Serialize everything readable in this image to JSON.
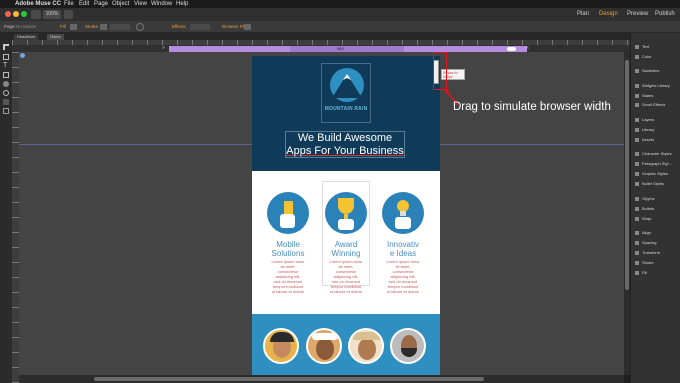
{
  "menubar": {
    "app_name": "Adobe Muse CC",
    "items": [
      "File",
      "Edit",
      "Page",
      "Object",
      "View",
      "Window",
      "Help"
    ]
  },
  "titlebar": {
    "zoom": "100%",
    "modes": [
      "Plan",
      "Design",
      "Preview",
      "Publish"
    ],
    "active_mode": "Design"
  },
  "controlbar": {
    "page_label": "Page:",
    "page_value": "No Master",
    "fill_label": "Fill",
    "stroke_label": "Stroke",
    "effects_label": "Effects",
    "browser_fill_label": "Browser Fill"
  },
  "tabs": [
    "Headerize",
    "Home"
  ],
  "breakpoint": {
    "width_value": "960",
    "tooltip_line1": "Resize to",
    "tooltip_line2": "525px"
  },
  "annotation": {
    "text": "Drag to simulate browser width"
  },
  "site": {
    "logo_text": "MOUNTAIN RAIN",
    "headline_line1": "We Build Awesome",
    "headline_line2": "Apps For Your Business",
    "features": [
      {
        "title_line1": "Mobile",
        "title_line2": "Solutions",
        "lorem": [
          "Lorem ipsum dolor",
          "sit amet,",
          "consectetur",
          "adipiscing elit,",
          "sed do eiusmod",
          "tempor incididunt",
          "ut labore et dolore"
        ],
        "icon": "phone-hand-icon"
      },
      {
        "title_line1": "Award",
        "title_line2": "Winning",
        "lorem": [
          "Lorem ipsum dolor",
          "sit amet,",
          "consectetur",
          "adipiscing elit,",
          "sed do eiusmod",
          "tempor incididunt",
          "ut labore et dolore"
        ],
        "icon": "trophy-icon"
      },
      {
        "title_line1": "Innovativ",
        "title_line2": "e Ideas",
        "lorem": [
          "Lorem ipsum dolor",
          "sit amet,",
          "consectetur",
          "adipiscing elit,",
          "sed do eiusmod",
          "tempor incididunt",
          "ut labore et dolore"
        ],
        "icon": "lightbulb-icon"
      }
    ]
  },
  "right_panel": [
    "Text",
    "Color",
    "Swatches",
    "Widgets Library",
    "States",
    "Scroll Effects",
    "Layers",
    "Library",
    "Assets",
    "Character Styles",
    "Paragraph Styl...",
    "Graphic Styles",
    "Bullet Styles",
    "Glyphs",
    "Bullets",
    "Wrap",
    "Align",
    "Spacing",
    "Transform",
    "Stroke",
    "Fill"
  ],
  "colors": {
    "hero_bg": "#0f3b59",
    "feature_blue": "#2b82b8",
    "team_bg": "#2f8fc0",
    "breakpoint_purple": "#b58ce0",
    "annotation_red": "#e0141e",
    "active_mode": "#e8a03a"
  }
}
